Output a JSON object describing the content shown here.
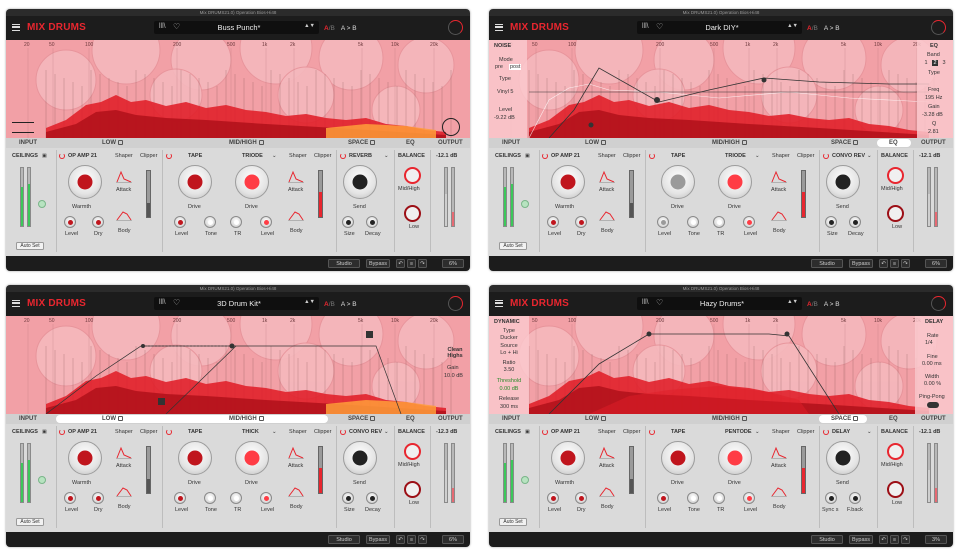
{
  "app": {
    "brand": "MIX DRUMS",
    "window_title": "Mix DRUMS21.0) Operation Bios-Hi48"
  },
  "common": {
    "ab_a": "A",
    "ab_sep": "/",
    "ab_b": "B",
    "ab_copy": "A > B",
    "freqs": [
      "20",
      "50",
      "100",
      "200",
      "500",
      "1k",
      "2k",
      "5k",
      "10k",
      "20k"
    ],
    "tabs": {
      "input": "INPUT",
      "low": "LOW",
      "midhigh": "MID/HIGH",
      "space": "SPACE",
      "eq": "EQ",
      "output": "OUTPUT"
    },
    "labels": {
      "ceilings": "CEILINGS",
      "op_amp": "OP AMP 21",
      "shaper": "Shaper",
      "clipper": "Clipper",
      "warmth": "Warmth",
      "level": "Level",
      "dry": "Dry",
      "attack": "Attack",
      "body": "Body",
      "tape": "TAPE",
      "drive": "Drive",
      "tone": "Tone",
      "tr": "TR",
      "send": "Send",
      "size": "Size",
      "decay": "Decay",
      "balance": "BALANCE",
      "midhigh": "Mid/High",
      "low": "Low",
      "autoset": "Auto Set",
      "studio": "Studio",
      "bypass": "Bypass"
    }
  },
  "panels": [
    {
      "preset": "Buss Punch*",
      "mode": "normal",
      "tape_flavor": "TRIODE",
      "space_type": "REVERB",
      "output": "-12.1 dB",
      "zoom": "6%",
      "highlight_tab": ""
    },
    {
      "preset": "Dark DIY*",
      "mode": "eq",
      "tape_flavor": "TRIODE",
      "space_type": "CONVO REV",
      "output": "-12.1 dB",
      "zoom": "6%",
      "highlight_tab": "eq",
      "noise": {
        "title": "NOISE",
        "mode_label": "Mode",
        "pre": "pre",
        "post": "post",
        "type_label": "Type",
        "type_value": "Vinyl 5",
        "level_label": "Level",
        "level_value": "-9.22 dB"
      },
      "eq": {
        "title": "EQ",
        "band_label": "Band",
        "bands": [
          "1",
          "2",
          "3"
        ],
        "type_label": "Type",
        "freq_label": "Freq",
        "freq_value": "195 Hz",
        "gain_label": "Gain",
        "gain_value": "-3.28 dB",
        "q_label": "Q",
        "q_value": "2.81"
      }
    },
    {
      "preset": "3D Drum Kit*",
      "mode": "split",
      "tape_flavor": "THICK",
      "space_type": "CONVO REV",
      "output": "-12.3 dB",
      "zoom": "6%",
      "highlight_tab": "lowmid",
      "clean": {
        "title": "Clean Highs",
        "gain_label": "Gain",
        "gain_value": "10.0 dB"
      }
    },
    {
      "preset": "Hazy Drums*",
      "mode": "delay",
      "tape_flavor": "PENTODE",
      "space_type": "DELAY",
      "output": "-12.1 dB",
      "zoom": "3%",
      "highlight_tab": "space",
      "dynamic": {
        "title": "DYNAMIC",
        "type_label": "Type",
        "type_value": "Ducker",
        "source_label": "Source",
        "source_value": "Lo + Hi",
        "ratio_label": "Ratio",
        "ratio_value": "3.50",
        "threshold_label": "Threshold",
        "threshold_value": "0.00 dB",
        "release_label": "Release",
        "release_value": "300 ms"
      },
      "delay": {
        "title": "DELAY",
        "rate_label": "Rate",
        "rate_value": "1/4",
        "fine_label": "Fine",
        "fine_value": "0.00 ms",
        "width_label": "Width",
        "width_value": "0.00 %",
        "pingpong_label": "Ping-Pong"
      },
      "space_knob_labels": [
        "Sync s",
        "F.back"
      ]
    }
  ],
  "colors": {
    "accent": "#e8262f",
    "display_bg": "#f2a0a6",
    "dark": "#1c1c1c",
    "panel": "#dadada"
  }
}
